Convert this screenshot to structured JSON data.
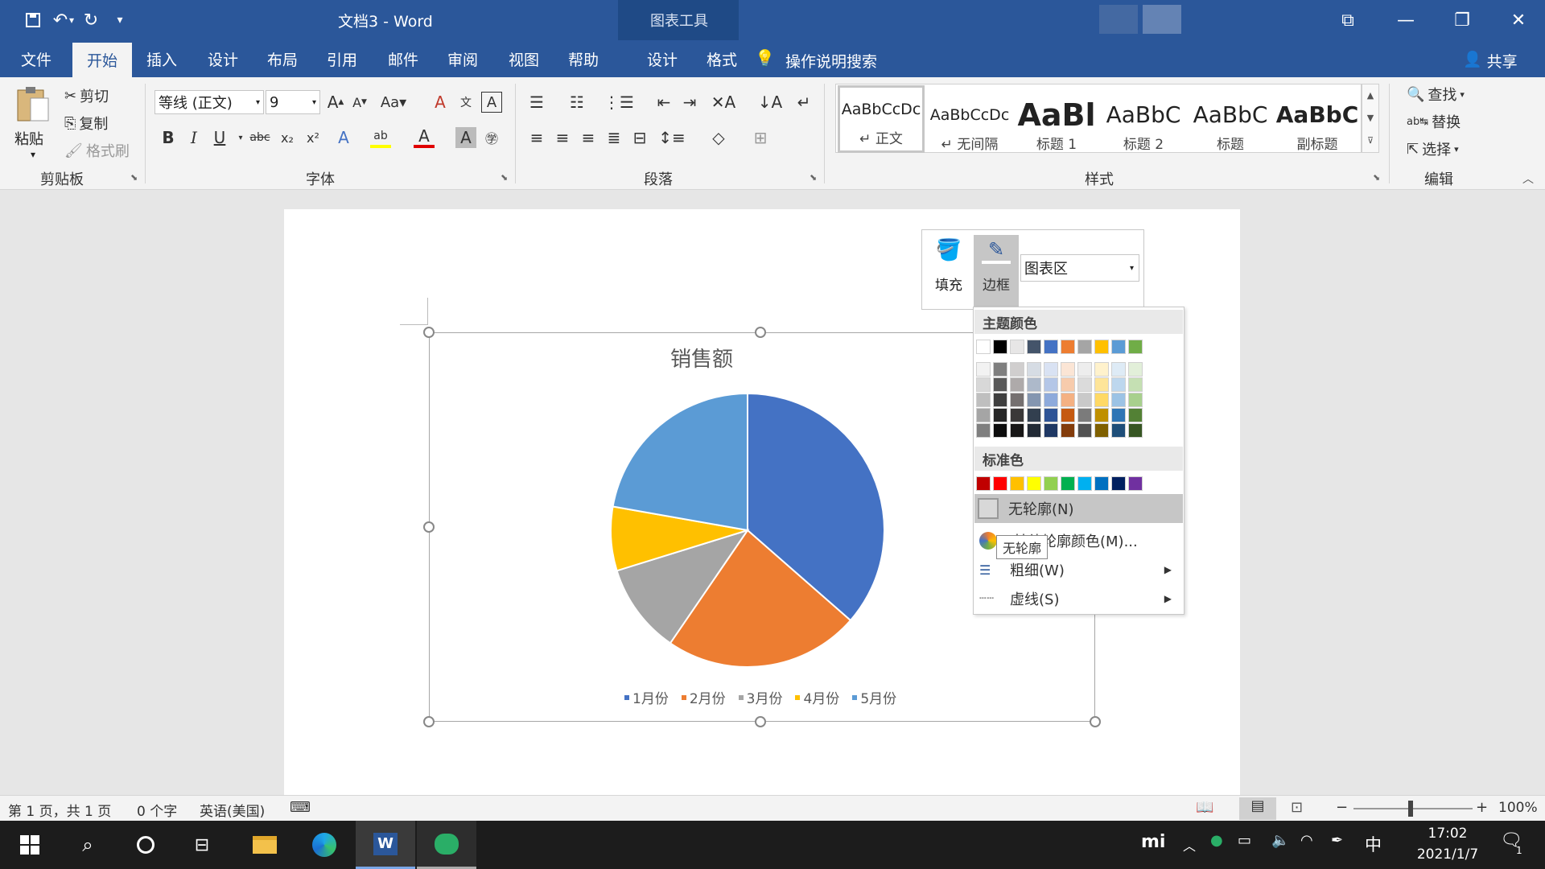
{
  "window": {
    "title": "文档3  -  Word",
    "context_title": "图表工具",
    "share": "共享"
  },
  "tabs": [
    "文件",
    "开始",
    "插入",
    "设计",
    "布局",
    "引用",
    "邮件",
    "审阅",
    "视图",
    "帮助",
    "设计",
    "格式"
  ],
  "search_hint": "操作说明搜索",
  "ribbon": {
    "clipboard": {
      "paste": "粘贴",
      "cut": "剪切",
      "copy": "复制",
      "format_painter": "格式刷",
      "label": "剪贴板"
    },
    "font": {
      "name": "等线 (正文)",
      "size": "9",
      "label": "字体"
    },
    "paragraph": {
      "label": "段落"
    },
    "styles": {
      "label": "样式",
      "items": [
        {
          "preview": "AaBbCcDc",
          "name": "↵ 正文"
        },
        {
          "preview": "AaBbCcDc",
          "name": "↵ 无间隔"
        },
        {
          "preview": "AaBl",
          "name": "标题 1"
        },
        {
          "preview": "AaBbC",
          "name": "标题 2"
        },
        {
          "preview": "AaBbC",
          "name": "标题"
        },
        {
          "preview": "AaBbC",
          "name": "副标题"
        }
      ]
    },
    "editing": {
      "find": "查找",
      "replace": "替换",
      "select": "选择",
      "label": "编辑"
    }
  },
  "mini_toolbar": {
    "fill": "填充",
    "border": "边框",
    "element": "图表区"
  },
  "color_panel": {
    "theme_header": "主题颜色",
    "standard_header": "标准色",
    "theme_top": [
      "#ffffff",
      "#000000",
      "#e7e6e6",
      "#44546a",
      "#4472c4",
      "#ed7d31",
      "#a5a5a5",
      "#ffc000",
      "#5b9bd5",
      "#70ad47"
    ],
    "theme_shades": [
      [
        "#f2f2f2",
        "#7f7f7f",
        "#d0cece",
        "#d6dce4",
        "#d9e2f3",
        "#fbe5d5",
        "#ededed",
        "#fff2cc",
        "#deebf6",
        "#e2efd9"
      ],
      [
        "#d8d8d8",
        "#595959",
        "#aeaaaa",
        "#adb9ca",
        "#b4c6e7",
        "#f7cbac",
        "#dbdbdb",
        "#fee599",
        "#bdd7ee",
        "#c5e0b3"
      ],
      [
        "#bfbfbf",
        "#3f3f3f",
        "#757070",
        "#8496b0",
        "#8eaadb",
        "#f4b183",
        "#c9c9c9",
        "#ffd965",
        "#9cc3e5",
        "#a8d08d"
      ],
      [
        "#a5a5a5",
        "#262626",
        "#3a3838",
        "#323f4f",
        "#2f5496",
        "#c55a11",
        "#7b7b7b",
        "#bf9000",
        "#2e75b5",
        "#538135"
      ],
      [
        "#7f7f7f",
        "#0c0c0c",
        "#171616",
        "#222a35",
        "#1f3864",
        "#833c0b",
        "#525252",
        "#7f6000",
        "#1e4e79",
        "#375623"
      ]
    ],
    "standard": [
      "#c00000",
      "#ff0000",
      "#ffc000",
      "#ffff00",
      "#92d050",
      "#00b050",
      "#00b0f0",
      "#0070c0",
      "#002060",
      "#7030a0"
    ],
    "no_outline": "无轮廓(N)",
    "more_colors": "其他轮廓颜色(M)...",
    "weight": "粗细(W)",
    "dashes": "虚线(S)",
    "tooltip": "无轮廓"
  },
  "chart_data": {
    "type": "pie",
    "title": "销售额",
    "categories": [
      "1月份",
      "2月份",
      "3月份",
      "4月份",
      "5月份"
    ],
    "values": [
      8.2,
      5.2,
      2.4,
      1.7,
      5.0
    ],
    "colors": [
      "#4472c4",
      "#ed7d31",
      "#a5a5a5",
      "#ffc000",
      "#5b9bd5"
    ],
    "legend": "bottom"
  },
  "status": {
    "page": "第 1 页，共 1 页",
    "words": "0 个字",
    "language": "英语(美国)",
    "zoom": "100%"
  },
  "taskbar": {
    "time": "17:02",
    "date": "2021/1/7",
    "ime": "中",
    "notif_count": "1"
  }
}
